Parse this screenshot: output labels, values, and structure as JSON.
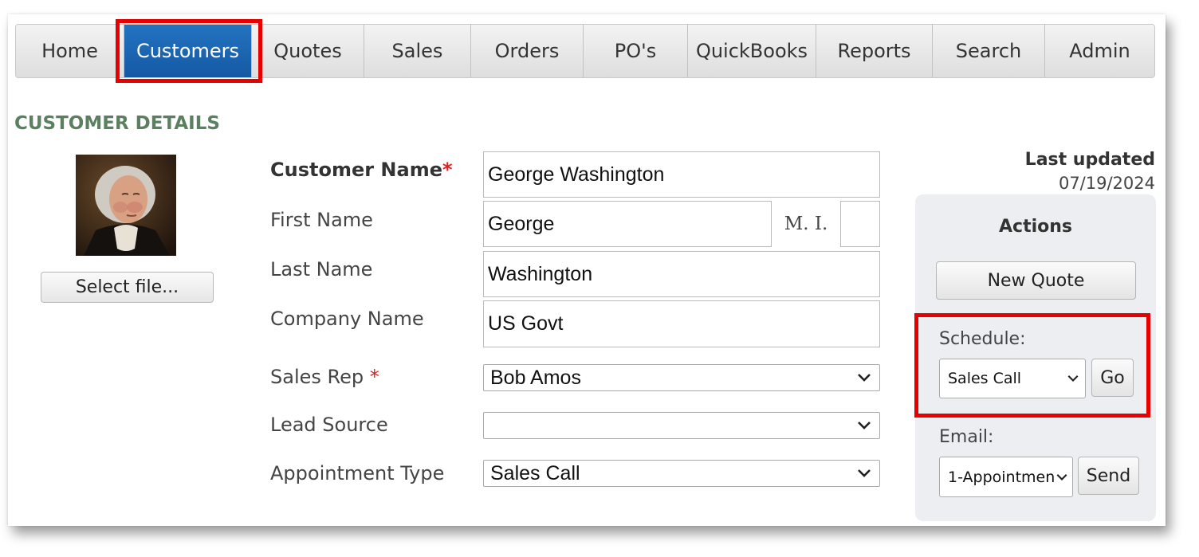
{
  "nav": {
    "items": [
      "Home",
      "Customers",
      "Quotes",
      "Sales",
      "Orders",
      "PO's",
      "QuickBooks",
      "Reports",
      "Search",
      "Admin"
    ],
    "active": "Customers"
  },
  "section_title": "CUSTOMER DETAILS",
  "photo": {
    "select_file_label": "Select file..."
  },
  "form": {
    "customer_name_label": "Customer Name",
    "customer_name_value": "George Washington",
    "first_name_label": "First Name",
    "first_name_value": "George",
    "mi_label": "M. I.",
    "mi_value": "",
    "last_name_label": "Last Name",
    "last_name_value": "Washington",
    "company_name_label": "Company Name",
    "company_name_value": "US Govt",
    "sales_rep_label": "Sales Rep",
    "sales_rep_value": "Bob Amos",
    "lead_source_label": "Lead Source",
    "lead_source_value": "",
    "appointment_type_label": "Appointment Type",
    "appointment_type_value": "Sales Call",
    "required_marker": "*"
  },
  "last_updated": {
    "label": "Last updated",
    "value": "07/19/2024"
  },
  "actions": {
    "title": "Actions",
    "new_quote_label": "New Quote",
    "schedule_label": "Schedule:",
    "schedule_value": "Sales Call",
    "go_label": "Go",
    "email_label": "Email:",
    "email_value": "1-Appointmen",
    "send_label": "Send"
  },
  "colors": {
    "active_tab": "#1a62ae",
    "highlight": "#e60000",
    "section_title": "#5a8060",
    "required": "#e02020"
  }
}
